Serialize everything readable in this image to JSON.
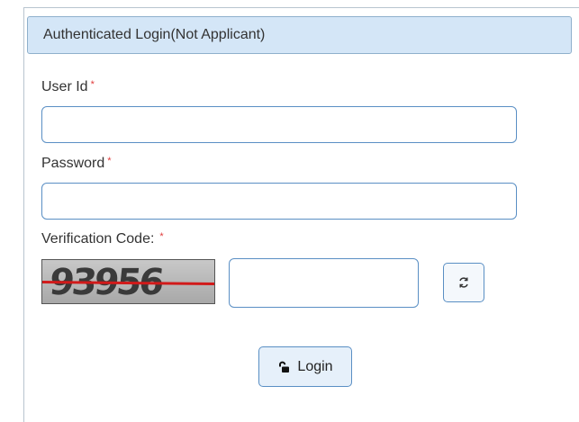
{
  "panel": {
    "title": "Authenticated Login(Not Applicant)"
  },
  "form": {
    "user_id_label": "User Id",
    "password_label": "Password",
    "verification_label": "Verification Code:",
    "required_marker": "*",
    "user_id_value": "",
    "password_value": "",
    "verification_value": ""
  },
  "captcha": {
    "text": "93956"
  },
  "buttons": {
    "login_label": "Login",
    "refresh_icon": "refresh-icon",
    "login_icon": "unlock-icon"
  },
  "colors": {
    "header_bg": "#d4e6f7",
    "input_border": "#5a8fc4",
    "required": "#e03b3b",
    "captcha_line": "#d11a1a"
  }
}
